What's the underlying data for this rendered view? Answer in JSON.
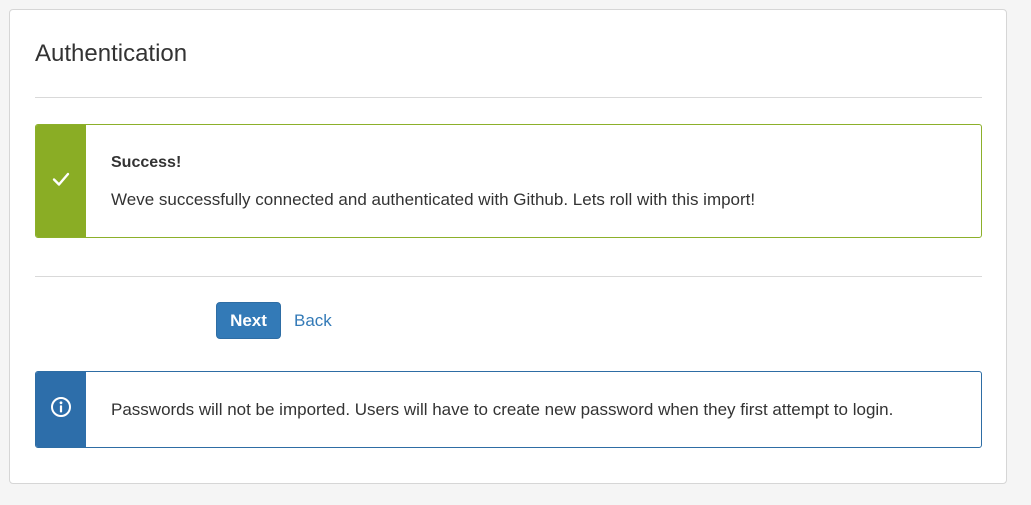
{
  "page": {
    "title": "Authentication"
  },
  "success_alert": {
    "icon": "check-icon",
    "heading": "Success!",
    "message": "Weve successfully connected and authenticated with Github. Lets roll with this import!",
    "accent_color": "#8aad25"
  },
  "actions": {
    "next_label": "Next",
    "back_label": "Back",
    "primary_color": "#337ab7"
  },
  "info_alert": {
    "icon": "info-icon",
    "message": "Passwords will not be imported. Users will have to create new password when they first attempt to login.",
    "accent_color": "#2d6eaa"
  }
}
